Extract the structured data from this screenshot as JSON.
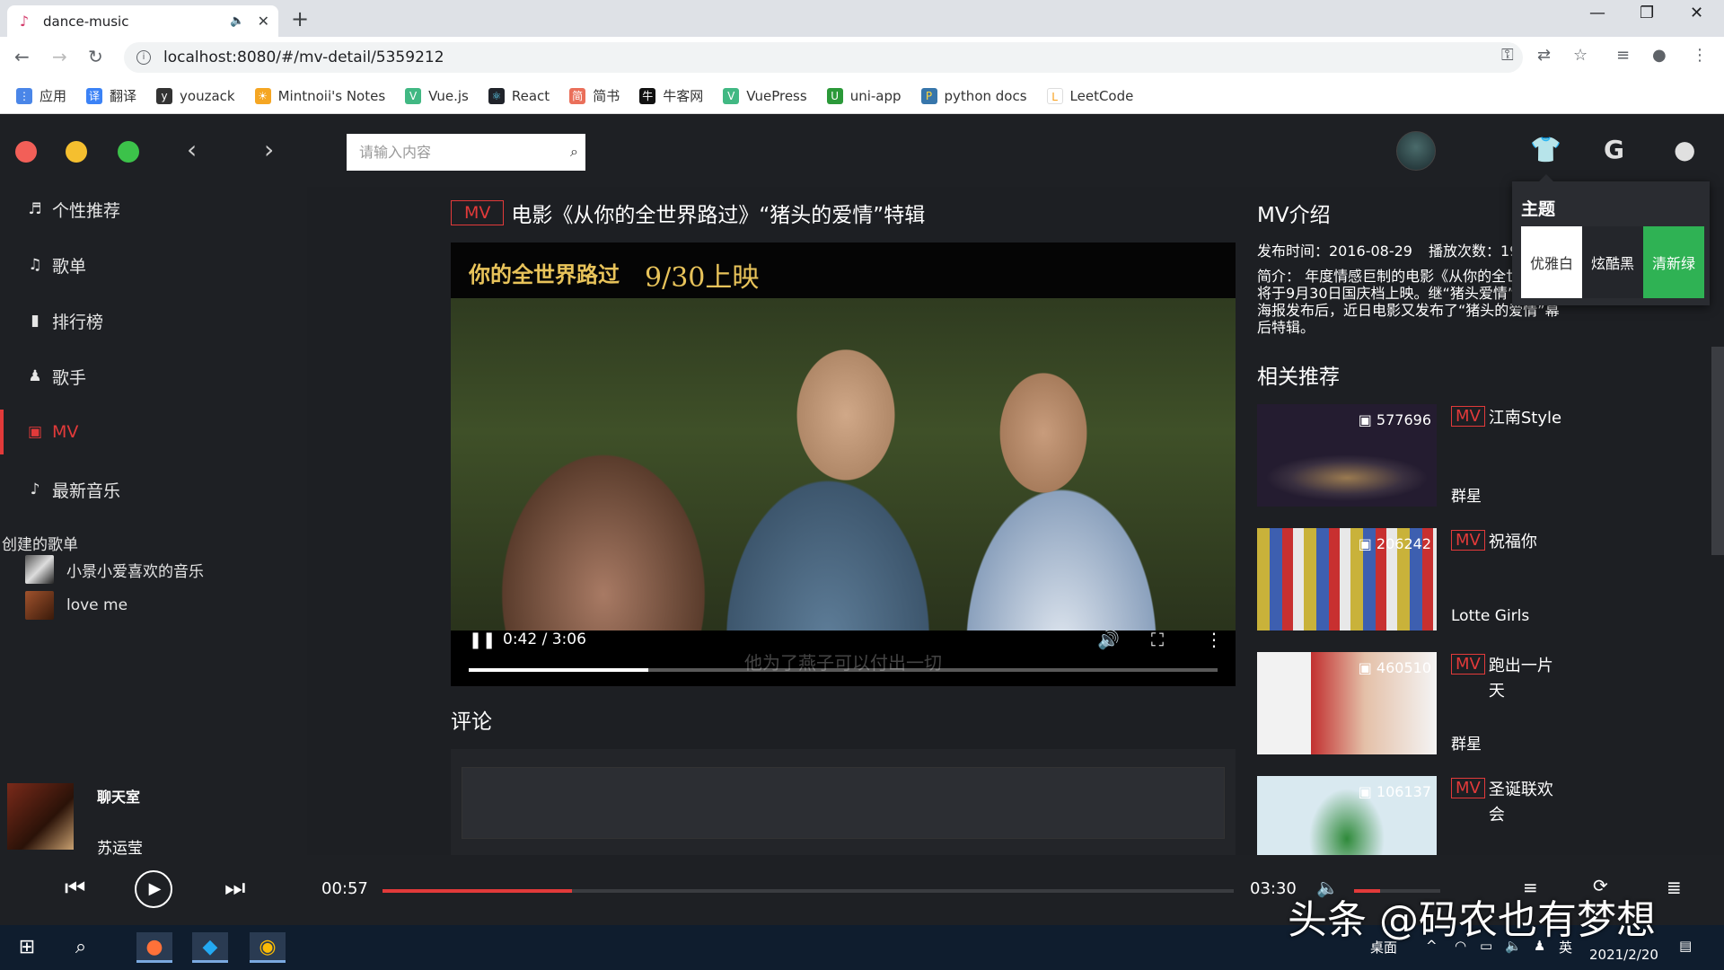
{
  "browser": {
    "tab_title": "dance-music",
    "url": "localhost:8080/#/mv-detail/5359212",
    "bookmarks": [
      "应用",
      "翻译",
      "youzack",
      "Mintnoii's Notes",
      "Vue.js",
      "React",
      "简书",
      "牛客网",
      "VuePress",
      "uni-app",
      "python docs",
      "LeetCode"
    ]
  },
  "header": {
    "search_placeholder": "请输入内容"
  },
  "sidebar": {
    "items": [
      {
        "label": "个性推荐",
        "icon": "music-note-icon"
      },
      {
        "label": "歌单",
        "icon": "playlist-icon"
      },
      {
        "label": "排行榜",
        "icon": "bar-chart-icon"
      },
      {
        "label": "歌手",
        "icon": "person-icon"
      },
      {
        "label": "MV",
        "icon": "video-icon"
      },
      {
        "label": "最新音乐",
        "icon": "music-icon"
      }
    ],
    "active": "MV",
    "created_title": "创建的歌单",
    "playlists": [
      {
        "name": "小景小爱喜欢的音乐"
      },
      {
        "name": "love me"
      }
    ],
    "now_playing": {
      "title": "聊天室",
      "artist": "苏运莹"
    }
  },
  "mv": {
    "tag": "MV",
    "title": "电影《从你的全世界路过》“猪头的爱情”特辑",
    "video_logo": "你的全世界路过",
    "video_date": "9/30上映",
    "current_time": "0:42 / 3:06",
    "progress": 0.24,
    "subtitle": "他为了燕子可以付出一切"
  },
  "comment": {
    "title": "评论"
  },
  "intro": {
    "title": "MV介绍",
    "publish_label": "发布时间：2016-08-29",
    "plays_label": "播放次数：19",
    "desc": "简介：  年度情感巨制的电影《从你的全世界路过》将于9月30日国庆档上映。继“猪头爱情”版预告和海报发布后，近日电影又发布了“猪头的爱情”幕后特辑。"
  },
  "related": {
    "title": "相关推荐",
    "items": [
      {
        "plays": "577696",
        "name": "江南Style",
        "artist": "群星"
      },
      {
        "plays": "206242",
        "name": "祝福你",
        "artist": "Lotte Girls"
      },
      {
        "plays": "460510",
        "name": "跑出一片天",
        "artist": "群星"
      },
      {
        "plays": "106137",
        "name": "圣诞联欢会",
        "artist": ""
      }
    ]
  },
  "theme": {
    "title": "主题",
    "options": [
      {
        "label": "优雅白",
        "bg": "#ffffff",
        "fg": "#333333"
      },
      {
        "label": "炫酷黑",
        "bg": "#24262b",
        "fg": "#ffffff"
      },
      {
        "label": "清新绿",
        "bg": "#2fb254",
        "fg": "#ffffff"
      }
    ]
  },
  "player": {
    "current": "00:57",
    "total": "03:30",
    "progress": 0.223,
    "volume": 0.3
  },
  "taskbar": {
    "desktop_label": "桌面",
    "ime": "英",
    "date": "2021/2/20"
  },
  "watermark": "头条 @码农也有梦想",
  "colors": {
    "accent": "#e23a3a",
    "green": "#2fb254"
  }
}
